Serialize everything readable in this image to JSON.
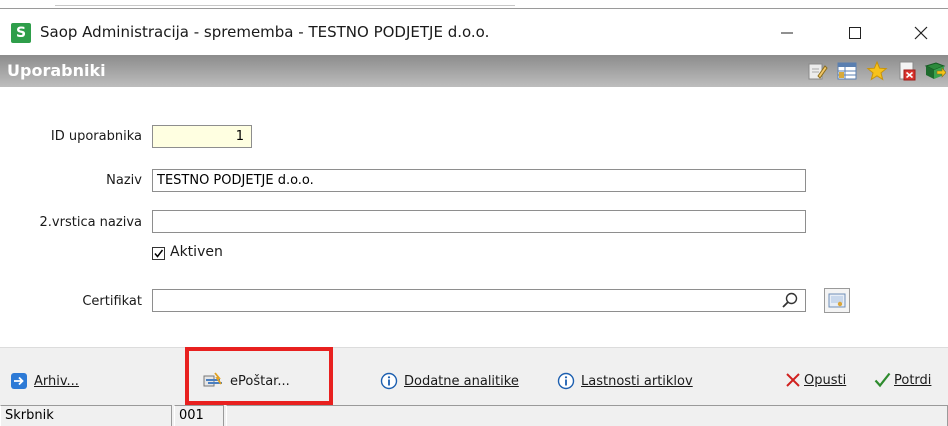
{
  "window": {
    "app_icon_letter": "S",
    "title": "Saop Administracija - sprememba - TESTNO PODJETJE d.o.o."
  },
  "header": {
    "title": "Uporabniki",
    "icons": [
      "edit-icon",
      "table-icon",
      "star-icon",
      "delete-document-icon",
      "book-exit-icon"
    ]
  },
  "form": {
    "id_label": "ID uporabnika",
    "id_value": "1",
    "naziv_label": "Naziv",
    "naziv_value": "TESTNO PODJETJE d.o.o.",
    "naziv2_label": "2.vrstica naziva",
    "naziv2_value": "",
    "aktiven_label": "Aktiven",
    "aktiven_checked": true,
    "certifikat_label": "Certifikat",
    "certifikat_value": ""
  },
  "buttons": {
    "arhiv": "Arhiv...",
    "epostar": "ePoštar...",
    "dodatne": "Dodatne analitike",
    "lastnosti": "Lastnosti artiklov",
    "opusti": "Opusti",
    "potrdi": "Potrdi"
  },
  "status": {
    "role": "Skrbnik",
    "code": "001"
  },
  "colors": {
    "highlight": "#e8201f",
    "header_gradient_top": "#8c8c8c",
    "id_field_bg": "#ffffe1"
  }
}
